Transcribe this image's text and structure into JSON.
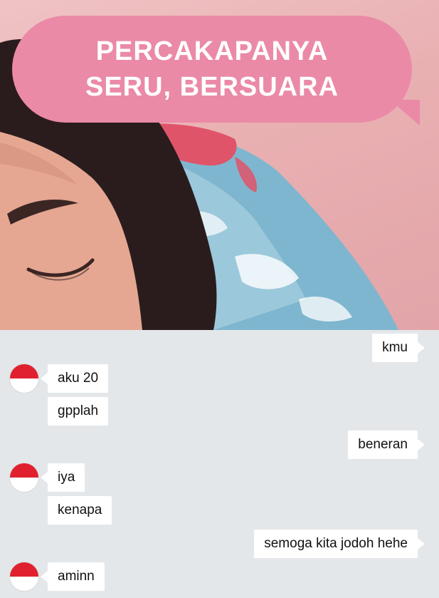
{
  "banner": {
    "line1": "PERCAKAPANYA",
    "line2": "SERU, BERSUARA",
    "color": "#ea8aa7"
  },
  "avatar": {
    "icon": "indonesia-flag-avatar",
    "colors": [
      "#e0202e",
      "#ffffff"
    ]
  },
  "messages": [
    {
      "side": "right",
      "text": "kmu"
    },
    {
      "side": "left",
      "text": "aku 20"
    },
    {
      "side": "left",
      "text": "gpplah"
    },
    {
      "side": "right",
      "text": "beneran"
    },
    {
      "side": "left",
      "text": "iya"
    },
    {
      "side": "left",
      "text": "kenapa"
    },
    {
      "side": "right",
      "text": "semoga kita jodoh hehe"
    },
    {
      "side": "left",
      "text": "aminn"
    }
  ]
}
